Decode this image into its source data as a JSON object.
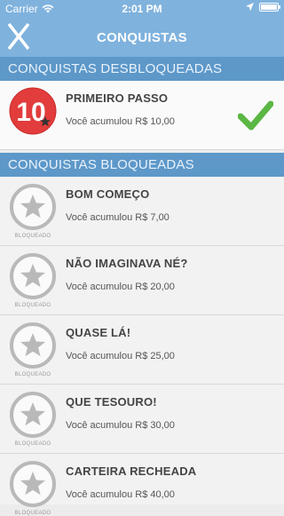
{
  "status": {
    "carrier": "Carrier",
    "time": "2:01 PM"
  },
  "header": {
    "title": "CONQUISTAS"
  },
  "sections": {
    "unlocked": "CONQUISTAS DESBLOQUEADAS",
    "locked": "CONQUISTAS BLOQUEADAS"
  },
  "unlocked": [
    {
      "name": "PRIMEIRO PASSO",
      "desc": "Você acumulou R$ 10,00",
      "badge": "10"
    }
  ],
  "locked": [
    {
      "name": "BOM COMEÇO",
      "desc": "Você acumulou R$ 7,00",
      "label": "BLOQUEADO"
    },
    {
      "name": "NÃO IMAGINAVA NÉ?",
      "desc": "Você acumulou R$ 20,00",
      "label": "BLOQUEADO"
    },
    {
      "name": "QUASE LÁ!",
      "desc": "Você acumulou R$ 25,00",
      "label": "BLOQUEADO"
    },
    {
      "name": "QUE TESOURO!",
      "desc": "Você acumulou R$ 30,00",
      "label": "BLOQUEADO"
    },
    {
      "name": "CARTEIRA RECHEADA",
      "desc": "Você acumulou R$ 40,00",
      "label": "BLOQUEADO"
    }
  ],
  "colors": {
    "header": "#7fb2dd",
    "section": "#5d98c9",
    "badge_red": "#e23c3c",
    "check_green": "#5bb744",
    "locked_gray": "#b9b9b9"
  }
}
